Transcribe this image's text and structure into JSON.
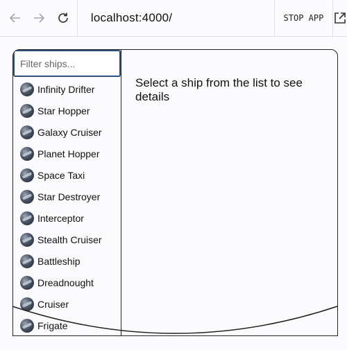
{
  "browser": {
    "url": "localhost:4000/",
    "stop_label": "STOP APP",
    "icons": [
      "back-arrow-icon",
      "forward-arrow-icon",
      "reload-icon",
      "open-external-icon"
    ]
  },
  "app": {
    "filter_placeholder": "Filter ships...",
    "detail_prompt": "Select a ship from the list to see details",
    "ships": [
      {
        "name": "Infinity Drifter"
      },
      {
        "name": "Star Hopper"
      },
      {
        "name": "Galaxy Cruiser"
      },
      {
        "name": "Planet Hopper"
      },
      {
        "name": "Space Taxi"
      },
      {
        "name": "Star Destroyer"
      },
      {
        "name": "Interceptor"
      },
      {
        "name": "Stealth Cruiser"
      },
      {
        "name": "Battleship"
      },
      {
        "name": "Dreadnought"
      },
      {
        "name": "Cruiser"
      },
      {
        "name": "Frigate"
      }
    ]
  }
}
